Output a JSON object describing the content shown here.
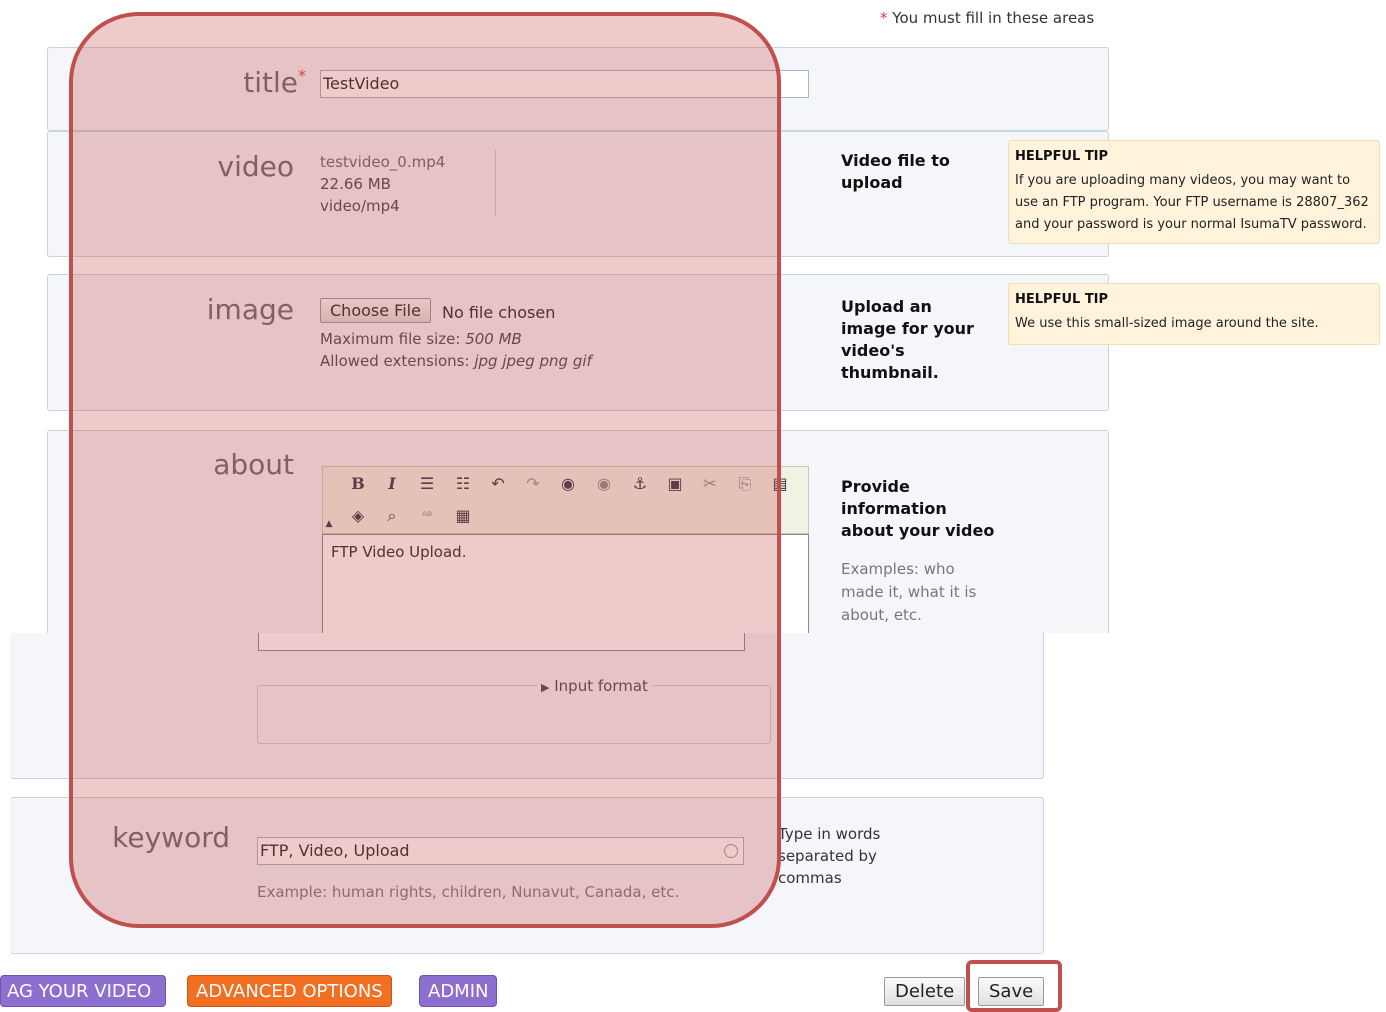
{
  "required_note": {
    "star": "*",
    "text": "You must fill in these areas"
  },
  "title_field": {
    "label": "title",
    "star": "*",
    "value": "TestVideo"
  },
  "video_field": {
    "label": "video",
    "filename": "testvideo_0.mp4",
    "size": "22.66 MB",
    "mime": "video/mp4",
    "description": "Video file to upload",
    "tip": {
      "title": "HELPFUL TIP",
      "body": "If you are uploading many videos, you may want to use an FTP program. Your FTP username is 28807_362 and your password is your normal IsumaTV password."
    }
  },
  "image_field": {
    "label": "image",
    "choose_button": "Choose File",
    "no_file": "No file chosen",
    "max_size_label": "Maximum file size:",
    "max_size_value": "500 MB",
    "extensions_label": "Allowed extensions:",
    "extensions_value": "jpg jpeg png gif",
    "description": "Upload an image for your video's thumbnail.",
    "tip": {
      "title": "HELPFUL TIP",
      "body": "We use this small-sized image around the site."
    }
  },
  "about_field": {
    "label": "about",
    "content": "FTP Video Upload.",
    "description": "Provide information about your video",
    "examples": "Examples: who made it, what it is about, etc.",
    "input_format": "Input format",
    "toolbar_icons": [
      "bold-icon",
      "italic-icon",
      "bullet-list-icon",
      "numbered-list-icon",
      "undo-icon",
      "redo-icon",
      "link-icon",
      "unlink-icon",
      "anchor-icon",
      "image-icon",
      "cut-icon",
      "copy-icon",
      "paste-icon",
      "media-icon",
      "find-icon",
      "spellcheck-icon",
      "table-icon"
    ]
  },
  "keyword_field": {
    "label": "keyword",
    "value": "FTP, Video, Upload",
    "example": "Example: human rights, children, Nunavut, Canada, etc.",
    "description": "Type in words separated by commas"
  },
  "bottom_bar": {
    "tag_video": "AG YOUR VIDEO",
    "advanced": "ADVANCED OPTIONS",
    "admin": "ADMIN",
    "delete": "Delete",
    "save": "Save"
  },
  "colors": {
    "purple": "#8c6fcf",
    "orange": "#f26f22",
    "highlight": "#c0504d",
    "required": "#e03a3a"
  }
}
